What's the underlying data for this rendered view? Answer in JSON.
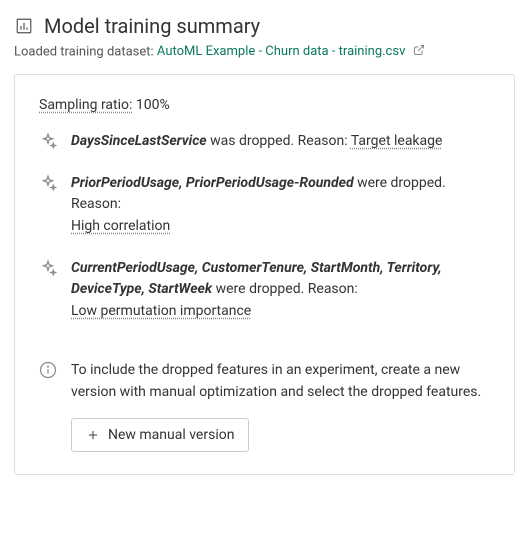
{
  "header": {
    "title": "Model training summary",
    "subtitle_prefix": "Loaded training dataset: ",
    "dataset_name": "AutoML Example - Churn data - training.csv"
  },
  "sampling": {
    "label": "Sampling ratio:",
    "value": "100%"
  },
  "insights": [
    {
      "features": "DaysSinceLastService",
      "suffix_text": " was dropped. Reason: ",
      "reason": "Target leakage",
      "reason_inline": true
    },
    {
      "features": "PriorPeriodUsage, PriorPeriodUsage-Rounded",
      "suffix_text": " were dropped. Reason:",
      "reason": "High correlation",
      "reason_inline": false
    },
    {
      "features": "CurrentPeriodUsage, CustomerTenure, StartMonth, Territory, DeviceType, StartWeek",
      "suffix_text": " were dropped. Reason:",
      "reason": "Low permutation importance",
      "reason_inline": false
    }
  ],
  "info": {
    "text": "To include the dropped features in an experiment, create a new version with manual optimization and select the dropped features.",
    "button_label": "New manual version"
  }
}
